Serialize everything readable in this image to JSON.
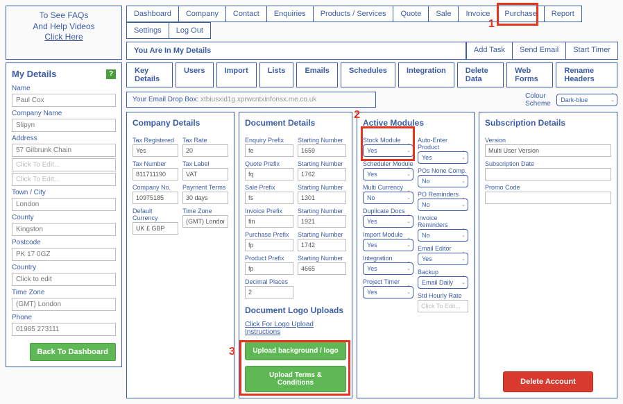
{
  "faq": {
    "line1": "To See FAQs",
    "line2": "And Help Videos",
    "cta": "Click Here"
  },
  "nav": [
    "Dashboard",
    "Company",
    "Contact",
    "Enquiries",
    "Products / Services",
    "Quote",
    "Sale",
    "Invoice",
    "Purchase",
    "Report",
    "Settings",
    "Log Out"
  ],
  "subnav_left": "You Are In My Details",
  "subnav_right": [
    "Add Task",
    "Send Email",
    "Start Timer"
  ],
  "sidebar": {
    "title": "My Details",
    "fields": [
      {
        "label": "Name",
        "value": "Paul Cox"
      },
      {
        "label": "Company Name",
        "value": "Slipyn"
      },
      {
        "label": "Address",
        "value": "57 Gilbrunk Chain"
      }
    ],
    "address_extra": [
      "Click To Edit...",
      "Click To Edit..."
    ],
    "fields2": [
      {
        "label": "Town / City",
        "value": "London"
      },
      {
        "label": "County",
        "value": "Kingston"
      },
      {
        "label": "Postcode",
        "value": "PK 17 0GZ"
      },
      {
        "label": "Country",
        "value": "Click to edit"
      },
      {
        "label": "Time Zone",
        "value": "(GMT) London"
      },
      {
        "label": "Phone",
        "value": "01985 273111"
      }
    ],
    "back": "Back To Dashboard"
  },
  "tabs": [
    "Key Details",
    "Users",
    "Import",
    "Lists",
    "Emails",
    "Schedules",
    "Integration",
    "Delete Data",
    "Web Forms",
    "Rename Headers"
  ],
  "dropbox_label": "Your Email Drop Box:",
  "dropbox_value": "xtbiusxid1g.xprwcntxinfonsx.me.co.uk",
  "colour_label": "Colour Scheme",
  "colour_value": "Dark-blue",
  "company_details": {
    "title": "Company Details",
    "left": [
      {
        "label": "Tax Registered",
        "value": "Yes"
      },
      {
        "label": "Tax Number",
        "value": "811711190"
      },
      {
        "label": "Company No.",
        "value": "10975185"
      },
      {
        "label": "Default Currency",
        "value": "UK £ GBP"
      }
    ],
    "right": [
      {
        "label": "Tax Rate",
        "value": "20"
      },
      {
        "label": "Tax Label",
        "value": "VAT"
      },
      {
        "label": "Payment Terms",
        "value": "30 days"
      },
      {
        "label": "Time Zone",
        "value": "(GMT) London"
      }
    ]
  },
  "document_details": {
    "title": "Document Details",
    "rows": [
      {
        "ll": "Enquiry Prefix",
        "lv": "fe",
        "rl": "Starting Number",
        "rv": "1659"
      },
      {
        "ll": "Quote Prefix",
        "lv": "fq",
        "rl": "Starting Number",
        "rv": "1762"
      },
      {
        "ll": "Sale Prefix",
        "lv": "fs",
        "rl": "Starting Number",
        "rv": "1301"
      },
      {
        "ll": "Invoice Prefix",
        "lv": "fin",
        "rl": "Starting Number",
        "rv": "1921"
      },
      {
        "ll": "Purchase Prefix",
        "lv": "fp",
        "rl": "Starting Number",
        "rv": "1742"
      },
      {
        "ll": "Product Prefix",
        "lv": "fp",
        "rl": "Starting Number",
        "rv": "4665"
      }
    ],
    "decimal_label": "Decimal Places",
    "decimal_value": "2",
    "logo_title": "Document Logo Uploads",
    "logo_link": "Click For Logo Upload Instructions",
    "btn_bg": "Upload background / logo",
    "btn_tc": "Upload Terms & Conditions"
  },
  "active_modules": {
    "title": "Active Modules",
    "rows": [
      {
        "ll": "Stock Module",
        "lv": "Yes",
        "rl": "Auto-Enter Product",
        "rv": "Yes"
      },
      {
        "ll": "Scheduler Module",
        "lv": "Yes",
        "rl": "POs None Comp.",
        "rv": "No"
      },
      {
        "ll": "Multi Currency",
        "lv": "No",
        "rl": "PO Reminders",
        "rv": "No"
      },
      {
        "ll": "Duplicate Docs",
        "lv": "Yes",
        "rl": "Invoice Reminders",
        "rv": "No"
      },
      {
        "ll": "Import Module",
        "lv": "Yes",
        "rl": "Email Editor",
        "rv": "Yes"
      },
      {
        "ll": "Integration",
        "lv": "Yes",
        "rl": "Backup",
        "rv": "Email Daily"
      },
      {
        "ll": "Project Timer",
        "lv": "Yes",
        "rl": "Std Hourly Rate",
        "rv": "Click To Edit..."
      }
    ]
  },
  "subscription": {
    "title": "Subscription Details",
    "version_label": "Version",
    "version_value": "Multi User Version",
    "subdate_label": "Subscription Date",
    "subdate_value": "",
    "promo_label": "Promo Code",
    "promo_value": "",
    "delete": "Delete Account"
  },
  "annotations": {
    "a1": "1",
    "a2": "2",
    "a3": "3"
  }
}
